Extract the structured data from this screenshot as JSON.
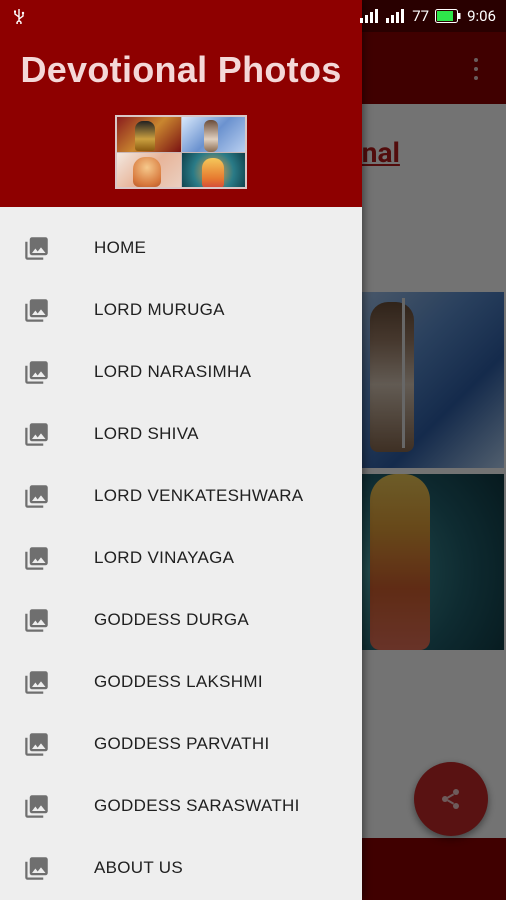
{
  "status_bar": {
    "signal_icon_1": "signal-bars-icon",
    "signal_icon_2": "signal-bars-icon",
    "battery_level": "77",
    "time": "9:06",
    "usb_icon": "usb-icon"
  },
  "drawer": {
    "title": "Devotional Photos",
    "menu": [
      {
        "label": "HOME",
        "icon": "photo-library-icon"
      },
      {
        "label": "LORD MURUGA",
        "icon": "photo-library-icon"
      },
      {
        "label": "LORD NARASIMHA",
        "icon": "photo-library-icon"
      },
      {
        "label": "LORD SHIVA",
        "icon": "photo-library-icon"
      },
      {
        "label": "LORD VENKATESHWARA",
        "icon": "photo-library-icon"
      },
      {
        "label": "LORD VINAYAGA",
        "icon": "photo-library-icon"
      },
      {
        "label": "GODDESS DURGA",
        "icon": "photo-library-icon"
      },
      {
        "label": "GODDESS LAKSHMI",
        "icon": "photo-library-icon"
      },
      {
        "label": "GODDESS PARVATHI",
        "icon": "photo-library-icon"
      },
      {
        "label": "GODDESS SARASWATHI",
        "icon": "photo-library-icon"
      },
      {
        "label": "ABOUT US",
        "icon": "photo-library-icon"
      }
    ]
  },
  "background_app": {
    "heading_partial": "vetional",
    "overflow_icon": "more-vert-icon",
    "fab_icon": "share-icon"
  },
  "colors": {
    "primary": "#8e0000",
    "primary_dark": "#5b0000",
    "drawer_bg": "#eeeeee",
    "fab": "#c62828",
    "heading": "#b71c1c"
  }
}
